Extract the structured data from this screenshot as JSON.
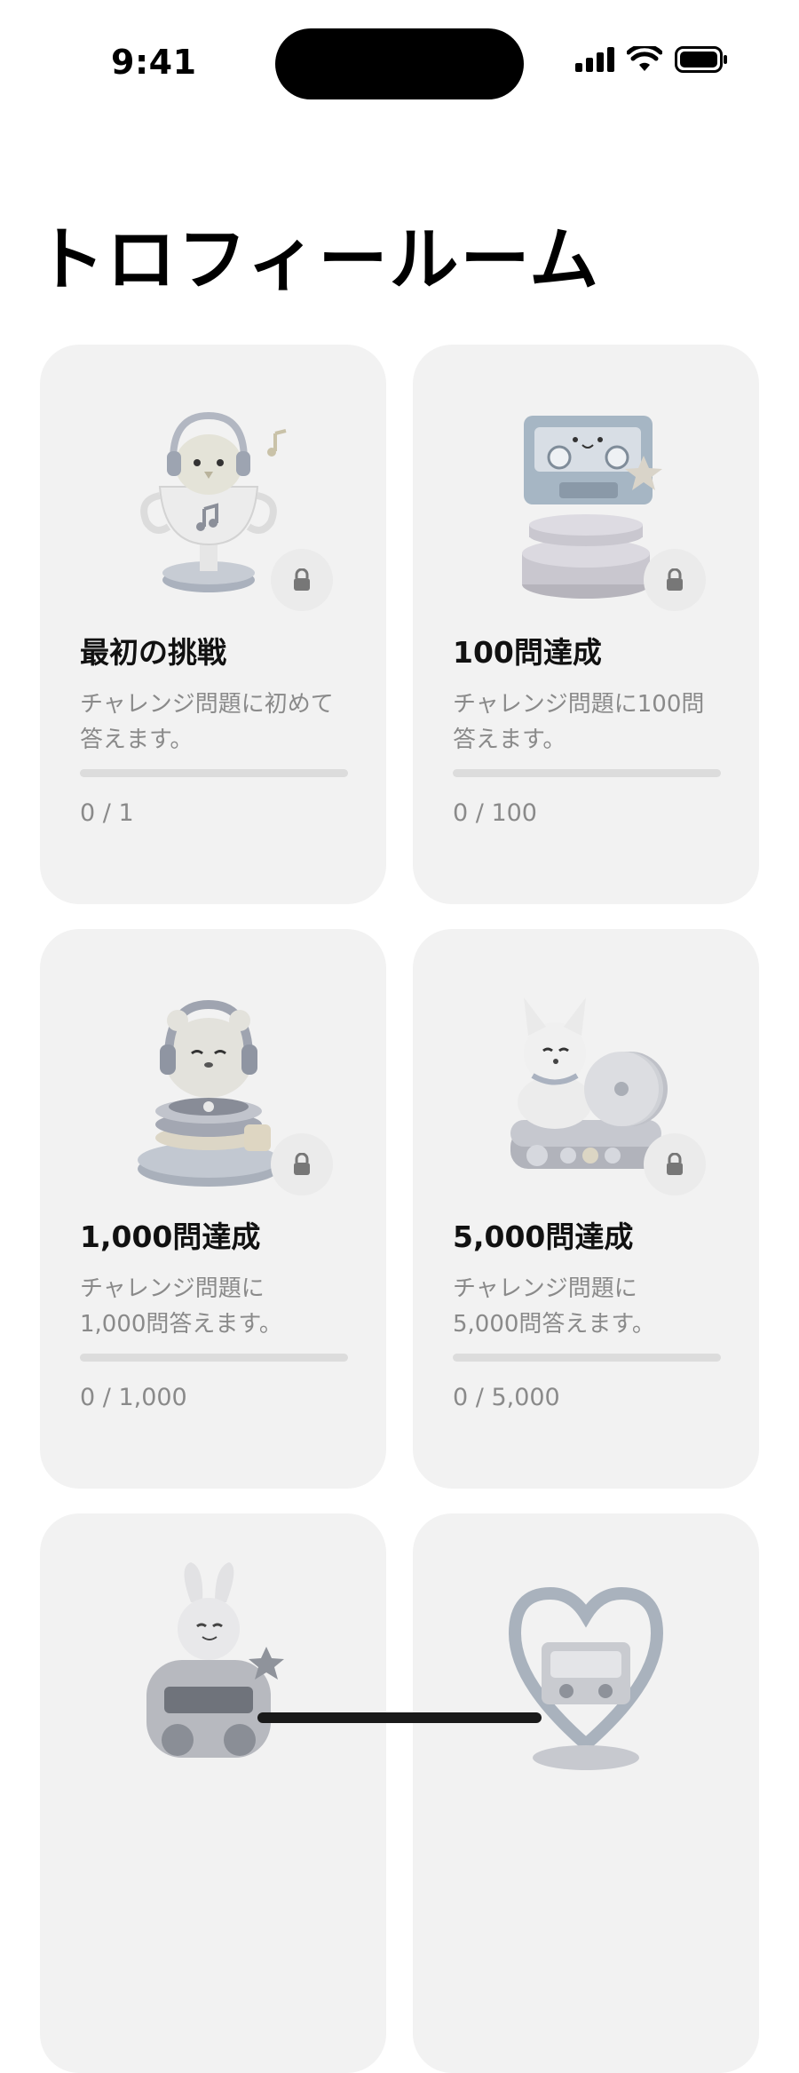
{
  "status_bar": {
    "time": "9:41"
  },
  "page_title": "トロフィールーム",
  "trophies": [
    {
      "title": "最初の挑戦",
      "desc_lines": [
        "チャレンジ問題に初めて",
        "答えます。"
      ],
      "progress_label": "0 / 1",
      "progress": 0,
      "locked": true,
      "icon": "chick-headphones-cup-icon"
    },
    {
      "title": "100問達成",
      "desc_lines": [
        "チャレンジ問題に100問",
        "答えます。"
      ],
      "progress_label": "0 / 100",
      "progress": 0,
      "locked": true,
      "icon": "cassette-tape-icon"
    },
    {
      "title": "1,000問達成",
      "desc_lines": [
        "チャレンジ問題に",
        "1,000問答えます。"
      ],
      "progress_label": "0 / 1,000",
      "progress": 0,
      "locked": true,
      "icon": "hamster-turntable-icon"
    },
    {
      "title": "5,000問達成",
      "desc_lines": [
        "チャレンジ問題に",
        "5,000問答えます。"
      ],
      "progress_label": "0 / 5,000",
      "progress": 0,
      "locked": true,
      "icon": "fox-records-icon"
    },
    {
      "title": "",
      "desc_lines": [],
      "progress_label": "",
      "progress": 0,
      "locked": true,
      "icon": "rabbit-boombox-icon"
    },
    {
      "title": "",
      "desc_lines": [],
      "progress_label": "",
      "progress": 0,
      "locked": true,
      "icon": "heart-cassette-icon"
    }
  ]
}
